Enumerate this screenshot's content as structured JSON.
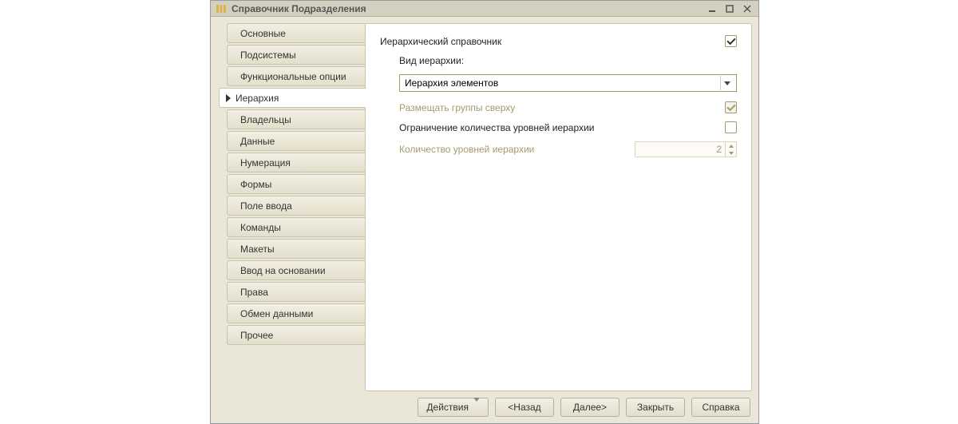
{
  "window": {
    "title": "Справочник Подразделения"
  },
  "sidebar": {
    "items": [
      {
        "label": "Основные"
      },
      {
        "label": "Подсистемы"
      },
      {
        "label": "Функциональные опции"
      },
      {
        "label": "Иерархия",
        "active": true
      },
      {
        "label": "Владельцы"
      },
      {
        "label": "Данные"
      },
      {
        "label": "Нумерация"
      },
      {
        "label": "Формы"
      },
      {
        "label": "Поле ввода"
      },
      {
        "label": "Команды"
      },
      {
        "label": "Макеты"
      },
      {
        "label": "Ввод на основании"
      },
      {
        "label": "Права"
      },
      {
        "label": "Обмен данными"
      },
      {
        "label": "Прочее"
      }
    ]
  },
  "content": {
    "hierarchical_label": "Иерархический справочник",
    "hierarchical_checked": true,
    "hierarchy_type_label": "Вид иерархии:",
    "hierarchy_type_value": "Иерархия элементов",
    "groups_top_label": "Размещать группы сверху",
    "groups_top_checked": true,
    "groups_top_disabled": true,
    "limit_levels_label": "Ограничение количества уровней иерархии",
    "limit_levels_checked": false,
    "levels_count_label": "Количество уровней иерархии",
    "levels_count_value": "2"
  },
  "footer": {
    "actions": "Действия",
    "back": "<Назад",
    "next": "Далее>",
    "close": "Закрыть",
    "help": "Справка"
  }
}
